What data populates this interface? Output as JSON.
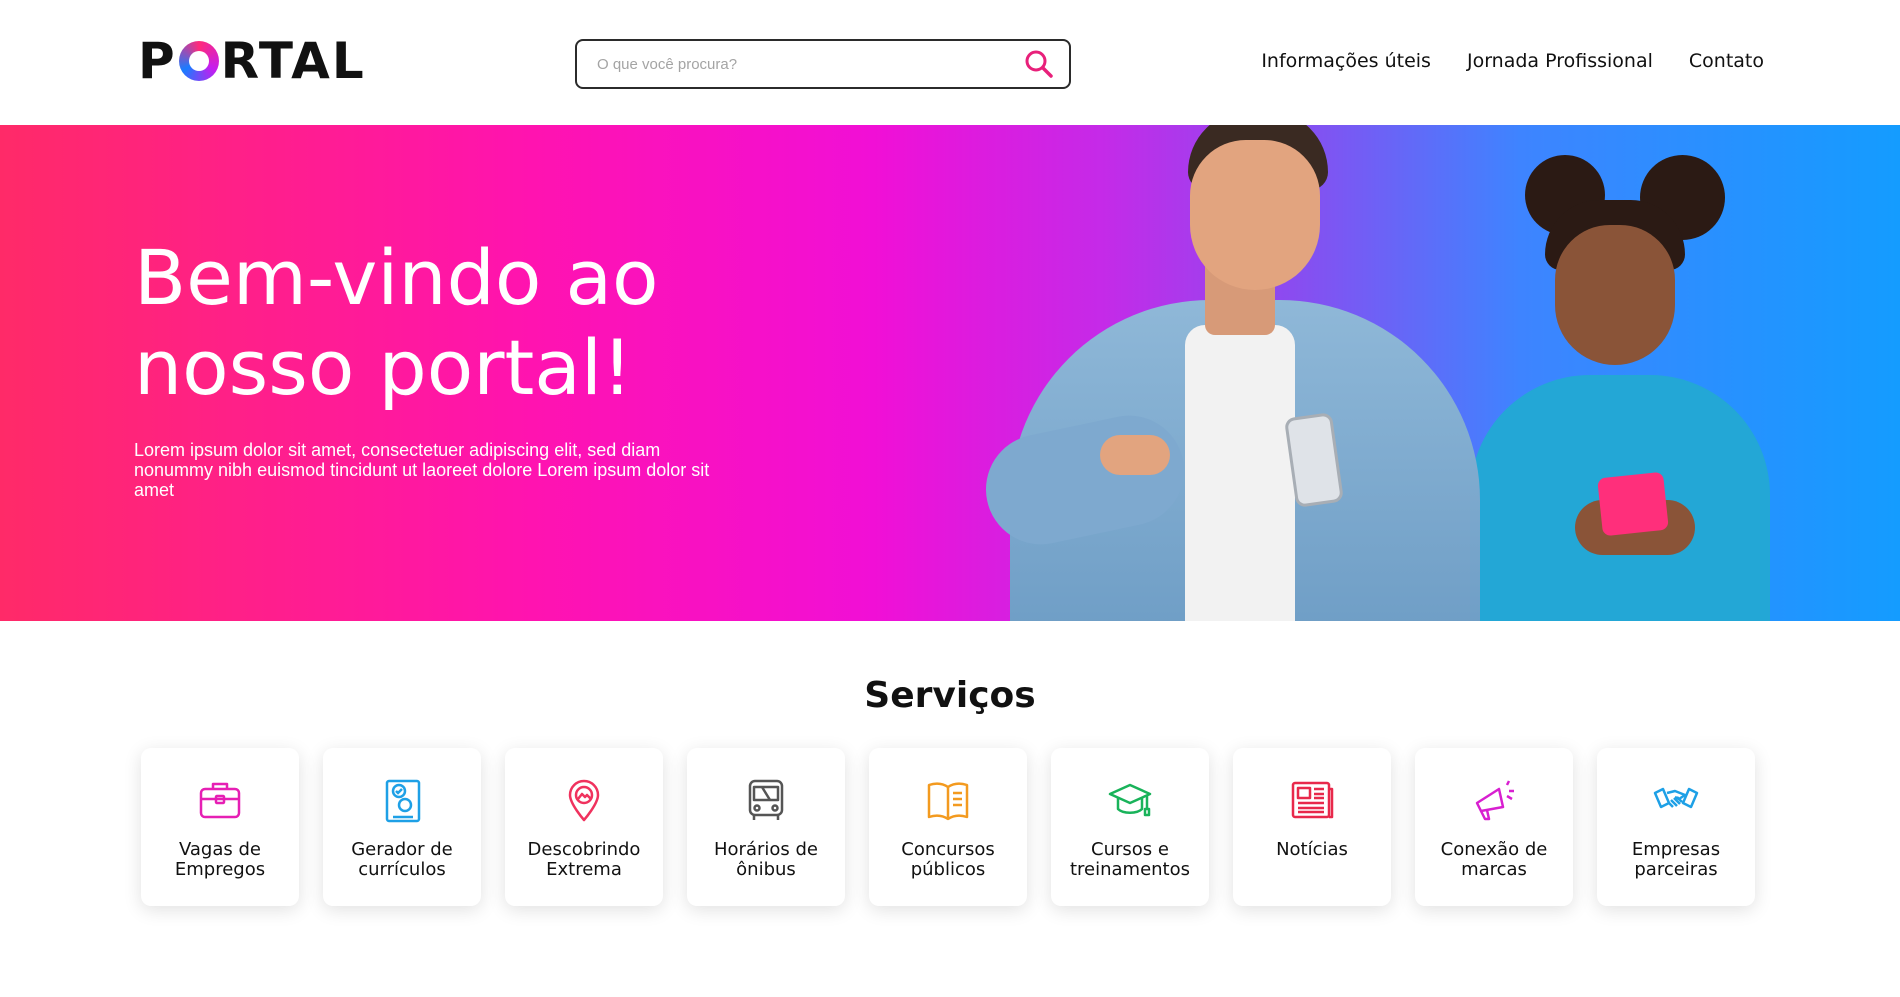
{
  "header": {
    "logo_text_left": "P",
    "logo_text_right": "RTAL",
    "search_placeholder": "O que você procura?",
    "nav": [
      {
        "label": "Informações úteis"
      },
      {
        "label": "Jornada Profissional"
      },
      {
        "label": "Contato"
      }
    ]
  },
  "hero": {
    "title_line1": "Bem-vindo ao",
    "title_line2": "nosso portal!",
    "subtitle": "Lorem ipsum dolor sit amet, consectetuer adipiscing elit, sed diam nonummy nibh euismod tincidunt ut laoreet dolore Lorem ipsum dolor sit amet",
    "gradient": [
      "#ff2a68",
      "#ff13b0",
      "#c52ae8",
      "#149cff"
    ]
  },
  "services": {
    "title": "Serviços",
    "items": [
      {
        "label": "Vagas de Empregos",
        "icon": "briefcase-icon",
        "color": "#e61fb4"
      },
      {
        "label": "Gerador de currículos",
        "icon": "resume-icon",
        "color": "#1ea0e6"
      },
      {
        "label": "Descobrindo Extrema",
        "icon": "map-pin-icon",
        "color": "#f0325e"
      },
      {
        "label": "Horários de ônibus",
        "icon": "bus-icon",
        "color": "#555555"
      },
      {
        "label": "Concursos públicos",
        "icon": "book-icon",
        "color": "#f39a1f"
      },
      {
        "label": "Cursos e treinamentos",
        "icon": "graduation-cap-icon",
        "color": "#19b35a"
      },
      {
        "label": "Notícias",
        "icon": "newspaper-icon",
        "color": "#e8294b"
      },
      {
        "label": "Conexão de marcas",
        "icon": "megaphone-icon",
        "color": "#d81fd0"
      },
      {
        "label": "Empresas parceiras",
        "icon": "handshake-icon",
        "color": "#1ea0e6"
      }
    ]
  }
}
